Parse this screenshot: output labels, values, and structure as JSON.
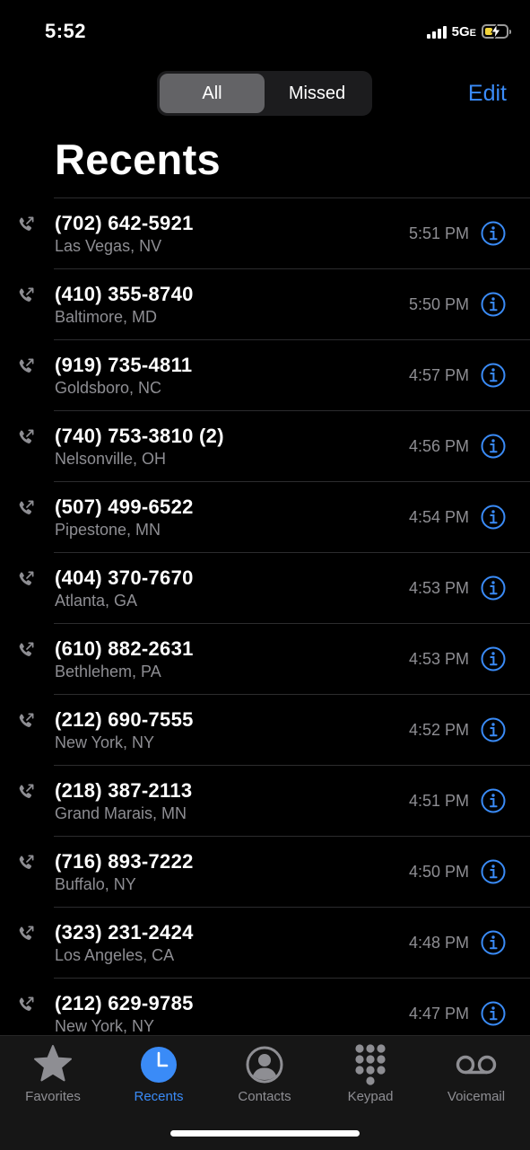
{
  "status_bar": {
    "time": "5:52",
    "network": "5G",
    "network_suffix": "E"
  },
  "header": {
    "segments": [
      {
        "label": "All",
        "selected": true
      },
      {
        "label": "Missed",
        "selected": false
      }
    ],
    "edit_label": "Edit",
    "title": "Recents"
  },
  "calls": [
    {
      "number": "(702) 642-5921",
      "location": "Las Vegas, NV",
      "time": "5:51 PM"
    },
    {
      "number": "(410) 355-8740",
      "location": "Baltimore, MD",
      "time": "5:50 PM"
    },
    {
      "number": "(919) 735-4811",
      "location": "Goldsboro, NC",
      "time": "4:57 PM"
    },
    {
      "number": "(740) 753-3810 (2)",
      "location": "Nelsonville, OH",
      "time": "4:56 PM"
    },
    {
      "number": "(507) 499-6522",
      "location": "Pipestone, MN",
      "time": "4:54 PM"
    },
    {
      "number": "(404) 370-7670",
      "location": "Atlanta, GA",
      "time": "4:53 PM"
    },
    {
      "number": "(610) 882-2631",
      "location": "Bethlehem, PA",
      "time": "4:53 PM"
    },
    {
      "number": "(212) 690-7555",
      "location": "New York, NY",
      "time": "4:52 PM"
    },
    {
      "number": "(218) 387-2113",
      "location": "Grand Marais, MN",
      "time": "4:51 PM"
    },
    {
      "number": "(716) 893-7222",
      "location": "Buffalo, NY",
      "time": "4:50 PM"
    },
    {
      "number": "(323) 231-2424",
      "location": "Los Angeles, CA",
      "time": "4:48 PM"
    },
    {
      "number": "(212) 629-9785",
      "location": "New York, NY",
      "time": "4:47 PM"
    }
  ],
  "tab_bar": {
    "tabs": [
      {
        "label": "Favorites",
        "icon": "star-icon",
        "active": false
      },
      {
        "label": "Recents",
        "icon": "clock-icon",
        "active": true
      },
      {
        "label": "Contacts",
        "icon": "person-circle-icon",
        "active": false
      },
      {
        "label": "Keypad",
        "icon": "keypad-icon",
        "active": false
      },
      {
        "label": "Voicemail",
        "icon": "voicemail-icon",
        "active": false
      }
    ]
  },
  "colors": {
    "accent": "#3a8bf7",
    "background": "#000000",
    "secondary_text": "#8e8e93",
    "battery_charge": "#f2d43b"
  }
}
